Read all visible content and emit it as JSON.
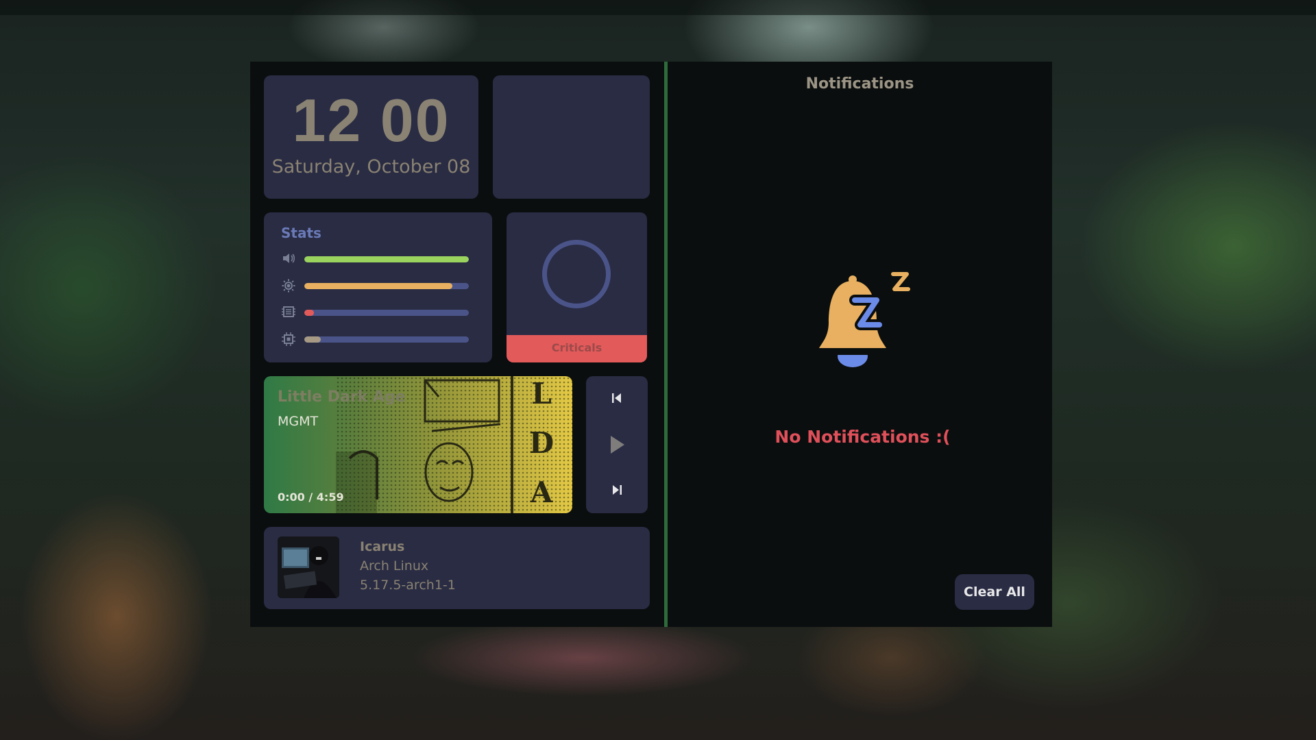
{
  "clock": {
    "time": "12 00",
    "date": "Saturday, October 08"
  },
  "stats": {
    "title": "Stats",
    "items": [
      {
        "icon": "volume-icon",
        "level": 1.0,
        "color": "#9bd35f"
      },
      {
        "icon": "brightness-icon",
        "level": 0.9,
        "color": "#e8b060"
      },
      {
        "icon": "memory-icon",
        "level": 0.06,
        "color": "#e35a5a"
      },
      {
        "icon": "cpu-icon",
        "level": 0.1,
        "color": "#a79a85"
      }
    ]
  },
  "criticals": {
    "label": "Criticals",
    "ring_color": "#4b5489",
    "bar_color": "#e35a5a"
  },
  "music": {
    "title": "Little Dark Age",
    "artist": "MGMT",
    "progress": "0:00 / 4:59",
    "album_letters": [
      "L",
      "D",
      "A"
    ]
  },
  "controls": {
    "prev": "previous-icon",
    "play": "play-icon",
    "next": "next-icon"
  },
  "system": {
    "hostname": "Icarus",
    "os": "Arch Linux",
    "kernel": "5.17.5-arch1-1"
  },
  "notifications": {
    "title": "Notifications",
    "empty_text": "No Notifications :(",
    "clear_label": "Clear All",
    "bell_color": "#e8b060",
    "accent_color": "#6b8be8"
  }
}
